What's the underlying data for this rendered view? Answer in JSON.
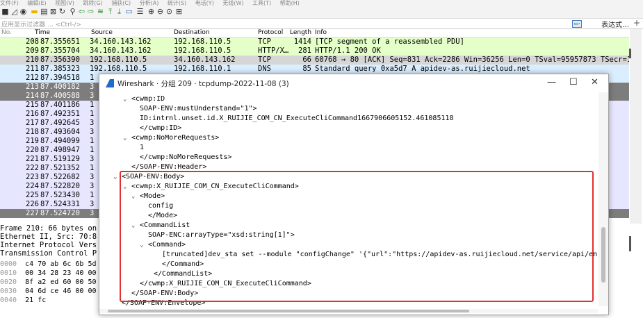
{
  "menubar": {
    "items": [
      "文件(F)",
      "编辑(E)",
      "视图(V)",
      "跳转(G)",
      "捕获(C)",
      "分析(A)",
      "统计(S)",
      "电话(Y)",
      "无线(W)",
      "工具(T)",
      "帮助(H)"
    ]
  },
  "filterbar": {
    "placeholder": "应用显示过滤器 … <Ctrl-/>",
    "expression_label": "表达式…",
    "plus": "+"
  },
  "packet_list": {
    "headers": {
      "no": "No.",
      "time": "Time",
      "source": "Source",
      "destination": "Destination",
      "protocol": "Protocol",
      "length": "Length",
      "info": "Info"
    },
    "rows": [
      {
        "no": "208",
        "time": "87.355651",
        "src": "34.160.143.162",
        "dst": "192.168.110.5",
        "proto": "TCP",
        "len": "1414",
        "info": "[TCP segment of a reassembled PDU]",
        "style": "http"
      },
      {
        "no": "209",
        "time": "87.355704",
        "src": "34.160.143.162",
        "dst": "192.168.110.5",
        "proto": "HTTP/X…",
        "len": "281",
        "info": "HTTP/1.1 200 OK",
        "style": "http"
      },
      {
        "no": "210",
        "time": "87.356390",
        "src": "192.168.110.5",
        "dst": "34.160.143.162",
        "proto": "TCP",
        "len": "66",
        "info": "60768 → 80 [ACK] Seq=831 Ack=2286 Win=36256 Len=0 TSval=95957873 TSecr=14…",
        "style": "sel"
      },
      {
        "no": "211",
        "time": "87.385323",
        "src": "192.168.110.5",
        "dst": "192.168.110.1",
        "proto": "DNS",
        "len": "85",
        "info": "Standard query 0xa5d7 A apidev-as.ruijiecloud.net",
        "style": "dns"
      },
      {
        "no": "212",
        "time": "87.394518",
        "src": "1",
        "dst": "",
        "proto": "",
        "len": "",
        "info": "",
        "style": "dns"
      },
      {
        "no": "213",
        "time": "87.400182",
        "src": "3",
        "dst": "",
        "proto": "",
        "len": "",
        "info": "",
        "style": "dark"
      },
      {
        "no": "214",
        "time": "87.400588",
        "src": "3",
        "dst": "",
        "proto": "",
        "len": "",
        "info": "",
        "style": "dark"
      },
      {
        "no": "215",
        "time": "87.401186",
        "src": "1",
        "dst": "",
        "proto": "",
        "len": "",
        "info": "",
        "style": "tcp"
      },
      {
        "no": "216",
        "time": "87.492351",
        "src": "1",
        "dst": "",
        "proto": "",
        "len": "",
        "info": "",
        "style": "tcp"
      },
      {
        "no": "217",
        "time": "87.492645",
        "src": "3",
        "dst": "",
        "proto": "",
        "len": "",
        "info": "",
        "style": "tcp"
      },
      {
        "no": "218",
        "time": "87.493604",
        "src": "3",
        "dst": "",
        "proto": "",
        "len": "",
        "info": "",
        "style": "tcp"
      },
      {
        "no": "219",
        "time": "87.494099",
        "src": "1",
        "dst": "",
        "proto": "",
        "len": "",
        "info": "",
        "style": "tcp"
      },
      {
        "no": "220",
        "time": "87.498947",
        "src": "1",
        "dst": "",
        "proto": "",
        "len": "",
        "info": "",
        "style": "tcp"
      },
      {
        "no": "221",
        "time": "87.519129",
        "src": "3",
        "dst": "",
        "proto": "",
        "len": "",
        "info": "",
        "style": "tcp"
      },
      {
        "no": "222",
        "time": "87.521352",
        "src": "1",
        "dst": "",
        "proto": "",
        "len": "",
        "info": "",
        "style": "tcp"
      },
      {
        "no": "223",
        "time": "87.522682",
        "src": "3",
        "dst": "",
        "proto": "",
        "len": "",
        "info": "",
        "style": "tcp"
      },
      {
        "no": "224",
        "time": "87.522820",
        "src": "3",
        "dst": "",
        "proto": "",
        "len": "",
        "info": "",
        "style": "tcp"
      },
      {
        "no": "225",
        "time": "87.523430",
        "src": "1",
        "dst": "",
        "proto": "",
        "len": "",
        "info": "",
        "style": "tcp"
      },
      {
        "no": "226",
        "time": "87.524331",
        "src": "3",
        "dst": "",
        "proto": "",
        "len": "",
        "info": "",
        "style": "tcp"
      },
      {
        "no": "227",
        "time": "87.524720",
        "src": "3",
        "dst": "",
        "proto": "",
        "len": "",
        "info": "",
        "style": "dark"
      }
    ]
  },
  "details": [
    "Frame 210: 66 bytes on",
    "Ethernet II, Src: 70:8",
    "Internet Protocol Vers",
    "Transmission Control P"
  ],
  "hex": [
    {
      "off": "0000",
      "bytes": "c4 70 ab 6c 6b 5d"
    },
    {
      "off": "0010",
      "bytes": "00 34 28 23 40 00"
    },
    {
      "off": "0020",
      "bytes": "8f a2 ed 60 00 50"
    },
    {
      "off": "0030",
      "bytes": "04 6d ce 46 00 00"
    },
    {
      "off": "0040",
      "bytes": "21 fc"
    }
  ],
  "dialog": {
    "title": "Wireshark · 分组 209 · tcpdump-2022-11-08 (3)",
    "controls": {
      "minimize": "—",
      "maximize": "☐",
      "close": "✕"
    },
    "tree": [
      {
        "toggle": "⌄",
        "text": "<cwmp:ID"
      },
      {
        "toggle": "",
        "text": "SOAP-ENV:mustUnderstand=\"1\">"
      },
      {
        "toggle": "",
        "text": "ID:intrnl.unset.id.X_RUIJIE_COM_CN_ExecuteCliCommand1667906605152.461085118"
      },
      {
        "toggle": "",
        "text": "</cwmp:ID>"
      },
      {
        "toggle": "⌄",
        "text": "<cwmp:NoMoreRequests>"
      },
      {
        "toggle": "",
        "text": "1"
      },
      {
        "toggle": "",
        "text": "</cwmp:NoMoreRequests>"
      },
      {
        "toggle": "",
        "text": "</SOAP-ENV:Header>"
      },
      {
        "toggle": "⌄",
        "text": "<SOAP-ENV:Body>"
      },
      {
        "toggle": "⌄",
        "text": "<cwmp:X_RUIJIE_COM_CN_ExecuteCliCommand>"
      },
      {
        "toggle": "⌄",
        "text": "<Mode>"
      },
      {
        "toggle": "",
        "text": "config"
      },
      {
        "toggle": "",
        "text": "</Mode>"
      },
      {
        "toggle": "⌄",
        "text": "<CommandList"
      },
      {
        "toggle": "",
        "text": "SOAP-ENC:arrayType=\"xsd:string[1]\">"
      },
      {
        "toggle": "⌄",
        "text": "<Command>"
      },
      {
        "toggle": "",
        "text": "[truncated]dev_sta set --module \"configChange\" '{\"url\":\"https://apidev-as.ruijiecloud.net/service/api/en"
      },
      {
        "toggle": "",
        "text": "</Command>"
      },
      {
        "toggle": "",
        "text": "</CommandList>"
      },
      {
        "toggle": "",
        "text": "</cwmp:X_RUIJIE_COM_CN_ExecuteCliCommand>"
      },
      {
        "toggle": "",
        "text": "</SOAP-ENV:Body>"
      },
      {
        "toggle": "",
        "text": "</SOAP-ENV:Envelope>"
      }
    ]
  },
  "colors": {
    "highlight_border": "#e03030",
    "selected_row": "#d6d6d6",
    "dns_row": "#daeeff",
    "http_row": "#e4ffc7",
    "tcp_row": "#e7e6ff",
    "dark_row": "#7d7d7d"
  }
}
